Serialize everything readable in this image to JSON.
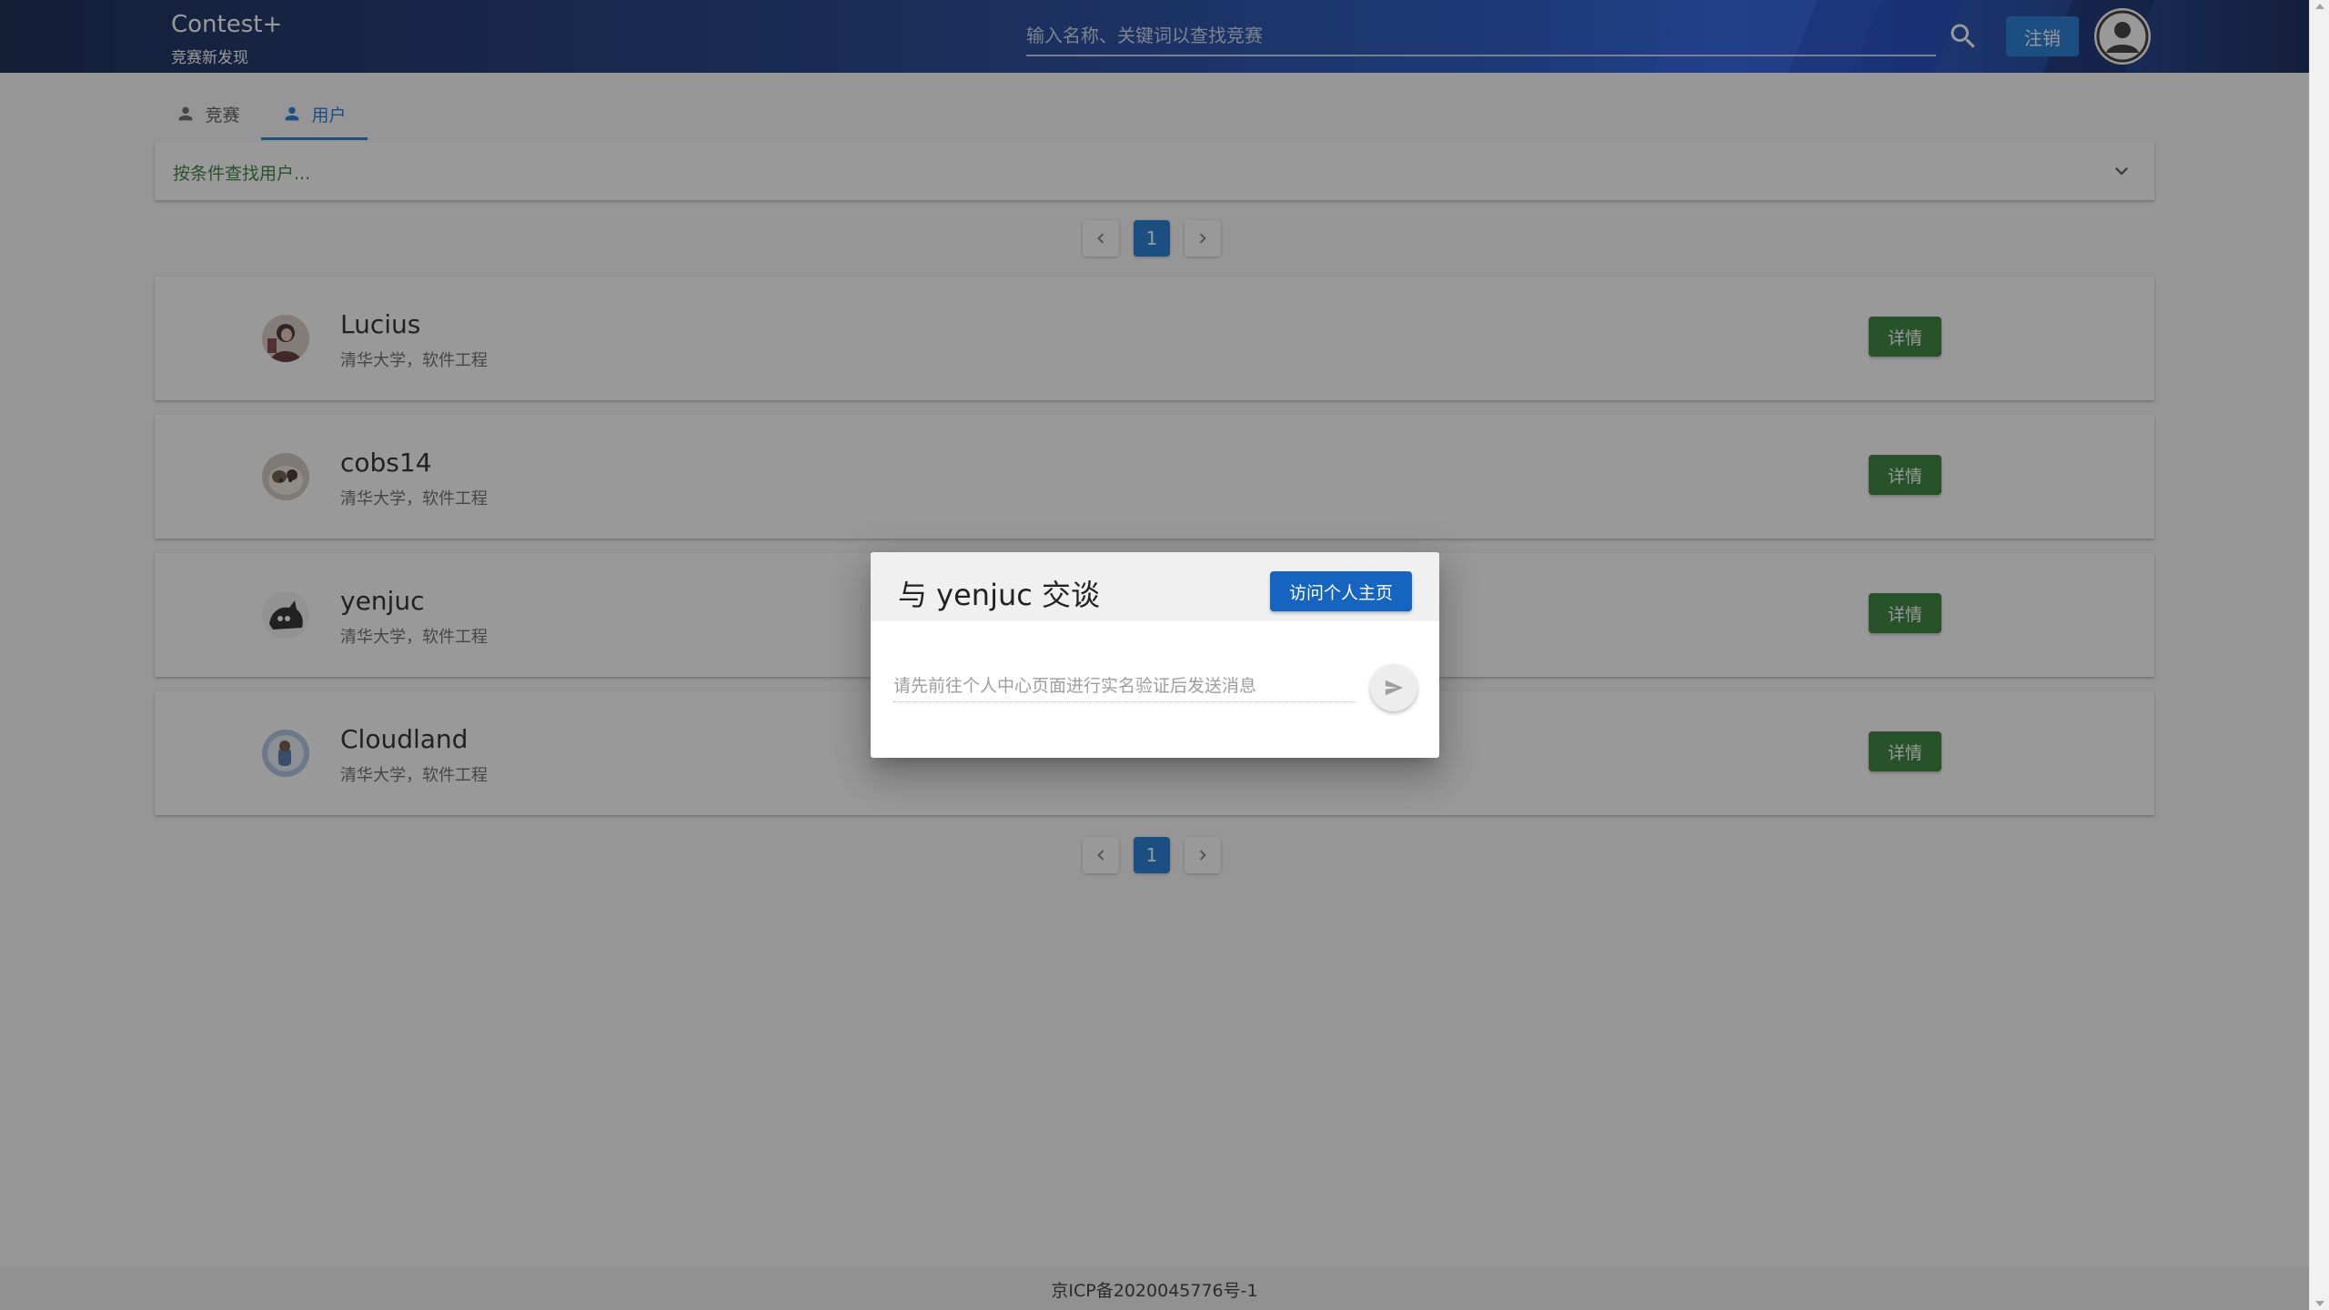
{
  "header": {
    "brand_title": "Contest+",
    "brand_subtitle": "竞赛新发现",
    "search_placeholder": "输入名称、关键词以查找竞赛",
    "logout_label": "注销"
  },
  "tabs": [
    {
      "label": "竞赛",
      "active": false
    },
    {
      "label": "用户",
      "active": true
    }
  ],
  "filter": {
    "label": "按条件查找用户..."
  },
  "pagination": {
    "current_page": "1"
  },
  "users": [
    {
      "name": "Lucius",
      "info": "清华大学，软件工程",
      "detail_label": "详情"
    },
    {
      "name": "cobs14",
      "info": "清华大学，软件工程",
      "detail_label": "详情"
    },
    {
      "name": "yenjuc",
      "info": "清华大学，软件工程",
      "detail_label": "详情"
    },
    {
      "name": "Cloudland",
      "info": "清华大学，软件工程",
      "detail_label": "详情"
    }
  ],
  "dialog": {
    "title": "与 yenjuc 交谈",
    "visit_label": "访问个人主页",
    "message_placeholder": "请先前往个人中心页面进行实名验证后发送消息"
  },
  "footer": {
    "icp": "京ICP备2020045776号-1"
  },
  "colors": {
    "primary": "#1976d2",
    "success": "#2e7d32",
    "overlay": "rgba(33,33,33,0.46)"
  },
  "icons": {
    "search": "search-icon",
    "tab_person": "person-icon",
    "filter_chevron": "chevron-down-icon",
    "prev": "chevron-left-icon",
    "next": "chevron-right-icon",
    "send": "send-icon",
    "account": "account-circle-icon"
  }
}
